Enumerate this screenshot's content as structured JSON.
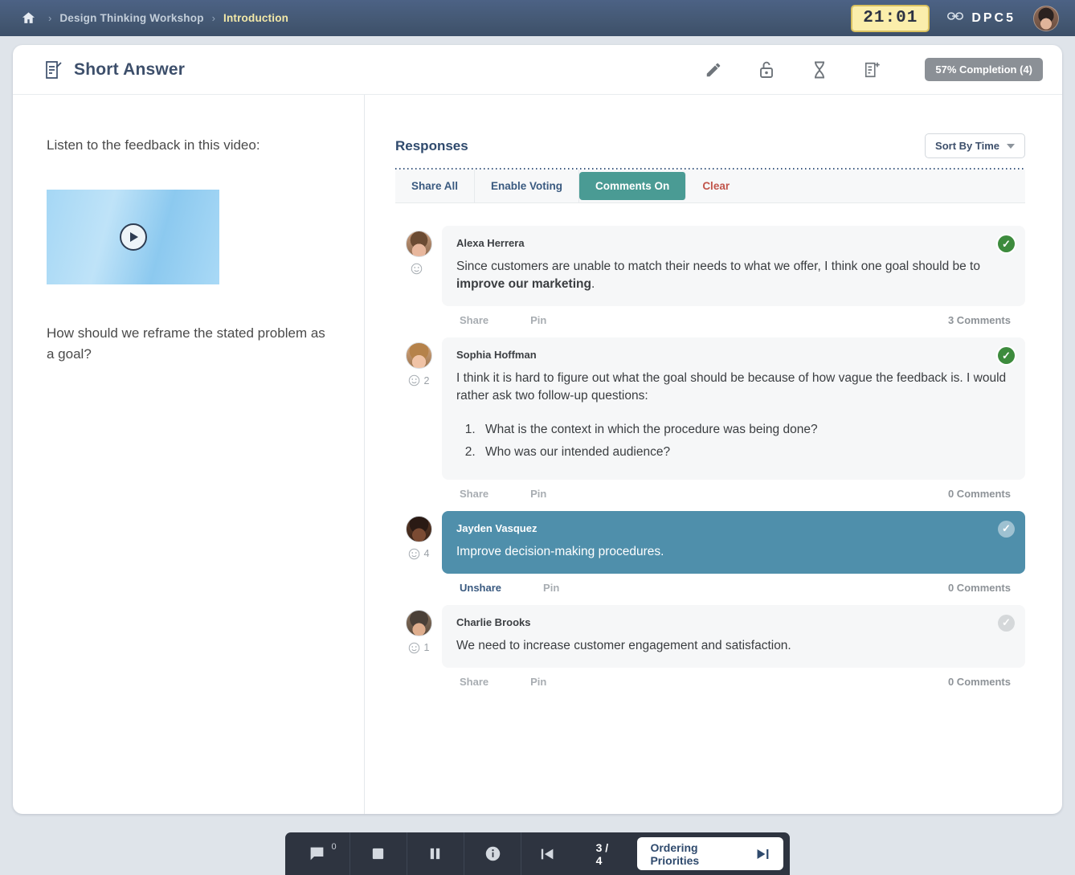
{
  "topbar": {
    "home_icon": "home-icon",
    "breadcrumbs": [
      {
        "label": "Design Thinking Workshop",
        "current": false
      },
      {
        "label": "Introduction",
        "current": true
      }
    ],
    "separator": "›",
    "timer": "21:01",
    "link_icon": "link-icon",
    "room_code": "DPC5",
    "avatar": "user-avatar"
  },
  "slide": {
    "icon": "short-answer-icon",
    "title": "Short Answer",
    "tools": [
      {
        "name": "edit-icon",
        "glyph": "pencil"
      },
      {
        "name": "unlock-icon",
        "glyph": "unlock"
      },
      {
        "name": "timer-icon",
        "glyph": "hourglass"
      },
      {
        "name": "add-note-icon",
        "glyph": "note-plus"
      }
    ],
    "completion_badge": "57% Completion (4)"
  },
  "left": {
    "prompt": "Listen to the feedback in this video:",
    "video": {
      "name": "video-thumbnail",
      "play_icon": "play-icon"
    },
    "question": "How should we reframe the stated problem as a goal?"
  },
  "responses_panel": {
    "title": "Responses",
    "sort_label": "Sort By Time",
    "sort_caret": "chevron-down-icon",
    "actions": [
      {
        "label": "Share All",
        "style": "normal"
      },
      {
        "label": "Enable Voting",
        "style": "normal"
      },
      {
        "label": "Comments On",
        "style": "active"
      },
      {
        "label": "Clear",
        "style": "danger"
      }
    ],
    "items": [
      {
        "author": "Alexa Herrera",
        "avatar": "avatar-alexa-herrera",
        "reaction_icon": "smiley-icon",
        "reaction_count": "",
        "text_before": "Since customers are unable to match their needs to what we offer, I think one goal should be to ",
        "text_bold": "improve our marketing",
        "text_after": ".",
        "list": [],
        "share_label": "Share",
        "pin_label": "Pin",
        "comments": "3 Comments",
        "checked": "on",
        "shared": false
      },
      {
        "author": "Sophia Hoffman",
        "avatar": "avatar-sophia-hoffman",
        "reaction_icon": "smiley-icon",
        "reaction_count": "2",
        "text_before": "I think it is hard to figure out what the goal should be because of how vague the feedback is. I would rather ask two follow-up questions:",
        "text_bold": "",
        "text_after": "",
        "list": [
          "What is the context in which the procedure was being done?",
          "Who was our intended audience?"
        ],
        "share_label": "Share",
        "pin_label": "Pin",
        "comments": "0 Comments",
        "checked": "on",
        "shared": false
      },
      {
        "author": "Jayden Vasquez",
        "avatar": "avatar-jayden-vasquez",
        "reaction_icon": "smiley-icon",
        "reaction_count": "4",
        "text_before": "Improve decision-making procedures.",
        "text_bold": "",
        "text_after": "",
        "list": [],
        "share_label": "Unshare",
        "pin_label": "Pin",
        "comments": "0 Comments",
        "checked": "off-light",
        "shared": true
      },
      {
        "author": "Charlie Brooks",
        "avatar": "avatar-charlie-brooks",
        "reaction_icon": "smiley-icon",
        "reaction_count": "1",
        "text_before": "We need to increase customer engagement and satisfaction.",
        "text_bold": "",
        "text_after": "",
        "list": [],
        "share_label": "Share",
        "pin_label": "Pin",
        "comments": "0 Comments",
        "checked": "off",
        "shared": false
      }
    ]
  },
  "bottombar": {
    "chat_icon": "chat-icon",
    "chat_count": "0",
    "stop_icon": "stop-icon",
    "pause_icon": "pause-icon",
    "info_icon": "info-icon",
    "prev_icon": "skip-previous-icon",
    "page": "3 / 4",
    "next_label": "Ordering Priorities",
    "next_icon": "skip-next-icon"
  },
  "colors": {
    "topbar": "#445873",
    "timer_bg": "#fbeeab",
    "accent_teal": "#4a9b94",
    "shared_bubble": "#4f8fab",
    "check_green": "#3d8b3d",
    "danger": "#c1554b",
    "navy_text": "#3d4f6b"
  }
}
